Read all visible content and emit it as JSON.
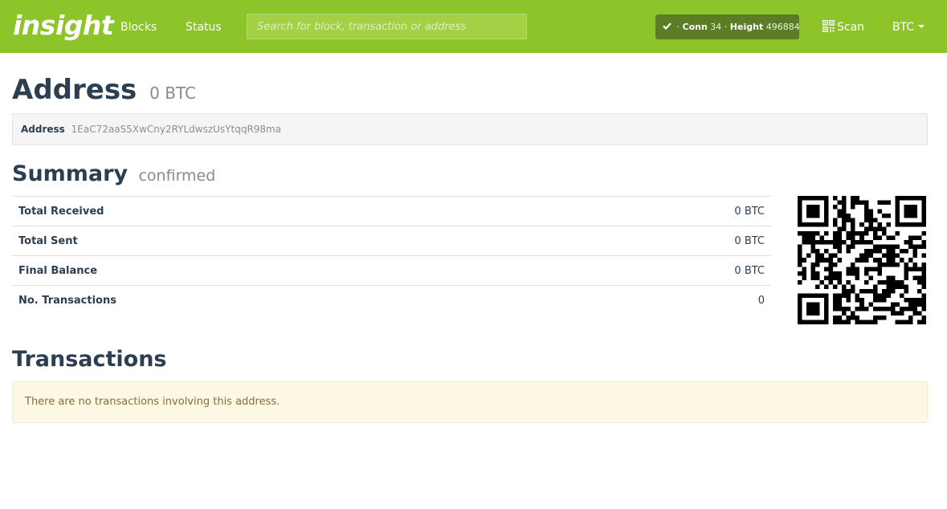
{
  "navbar": {
    "brand": "insight",
    "links": [
      "Blocks",
      "Status"
    ],
    "search_placeholder": "Search for block, transaction or address",
    "status": {
      "conn_label": "Conn",
      "conn_value": "34",
      "height_label": "Height",
      "height_value": "496884"
    },
    "scan_label": "Scan",
    "currency": "BTC",
    "colors": {
      "bar": "#8dc429",
      "status_pill": "#5c7d26"
    }
  },
  "address": {
    "title": "Address",
    "balance": "0 BTC",
    "label": "Address",
    "value": "1EaC72aaS5XwCny2RYLdwszUsYtqqR98ma"
  },
  "summary": {
    "title": "Summary",
    "subtitle": "confirmed",
    "rows": [
      {
        "label": "Total Received",
        "value": "0 BTC"
      },
      {
        "label": "Total Sent",
        "value": "0 BTC"
      },
      {
        "label": "Final Balance",
        "value": "0 BTC"
      },
      {
        "label": "No. Transactions",
        "value": "0"
      }
    ]
  },
  "transactions": {
    "title": "Transactions",
    "empty_message": "There are no transactions involving this address."
  }
}
